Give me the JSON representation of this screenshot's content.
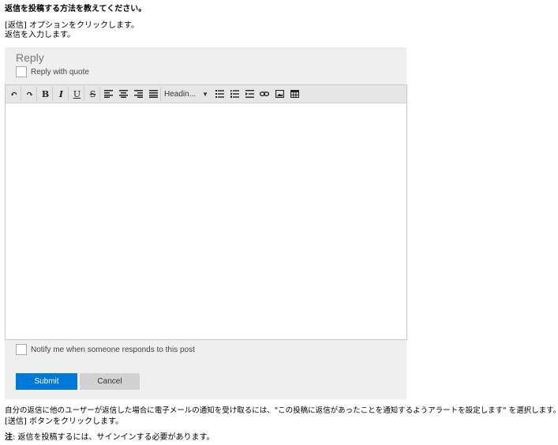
{
  "instructions": {
    "heading": "返信を投稿する方法を教えてください。",
    "step1": "[返信] オプションをクリックします。",
    "step2": "返信を入力します。"
  },
  "form": {
    "title": "Reply",
    "quote_label": "Reply with quote",
    "heading_select": "Headin...",
    "notify_label": "Notify me when someone responds to this post",
    "submit_label": "Submit",
    "cancel_label": "Cancel"
  },
  "toolbar": {
    "undo": "↶",
    "redo": "↷",
    "bold": "B",
    "italic": "I",
    "underline": "U",
    "strike": "S",
    "caret": "▼"
  },
  "footer": {
    "line1": "自分の返信に他のユーザーが返信した場合に電子メールの通知を受け取るには、\"この投稿に返信があったことを通知するようアラートを設定します\" を選択します。",
    "line2": "[送信] ボタンをクリックします。",
    "note_label": "注",
    "note_text": ": 返信を投稿するには、サインインする必要があります。"
  },
  "colors": {
    "submit": "#0078d7",
    "cancel": "#d2d2d2",
    "panel": "#efefef"
  },
  "icons": [
    "undo-icon",
    "redo-icon",
    "bold-icon",
    "italic-icon",
    "underline-icon",
    "strikethrough-icon",
    "align-left-icon",
    "align-center-icon",
    "align-right-icon",
    "justify-icon",
    "bullet-list-icon",
    "numbered-list-icon",
    "indent-icon",
    "link-icon",
    "image-icon",
    "table-icon"
  ]
}
